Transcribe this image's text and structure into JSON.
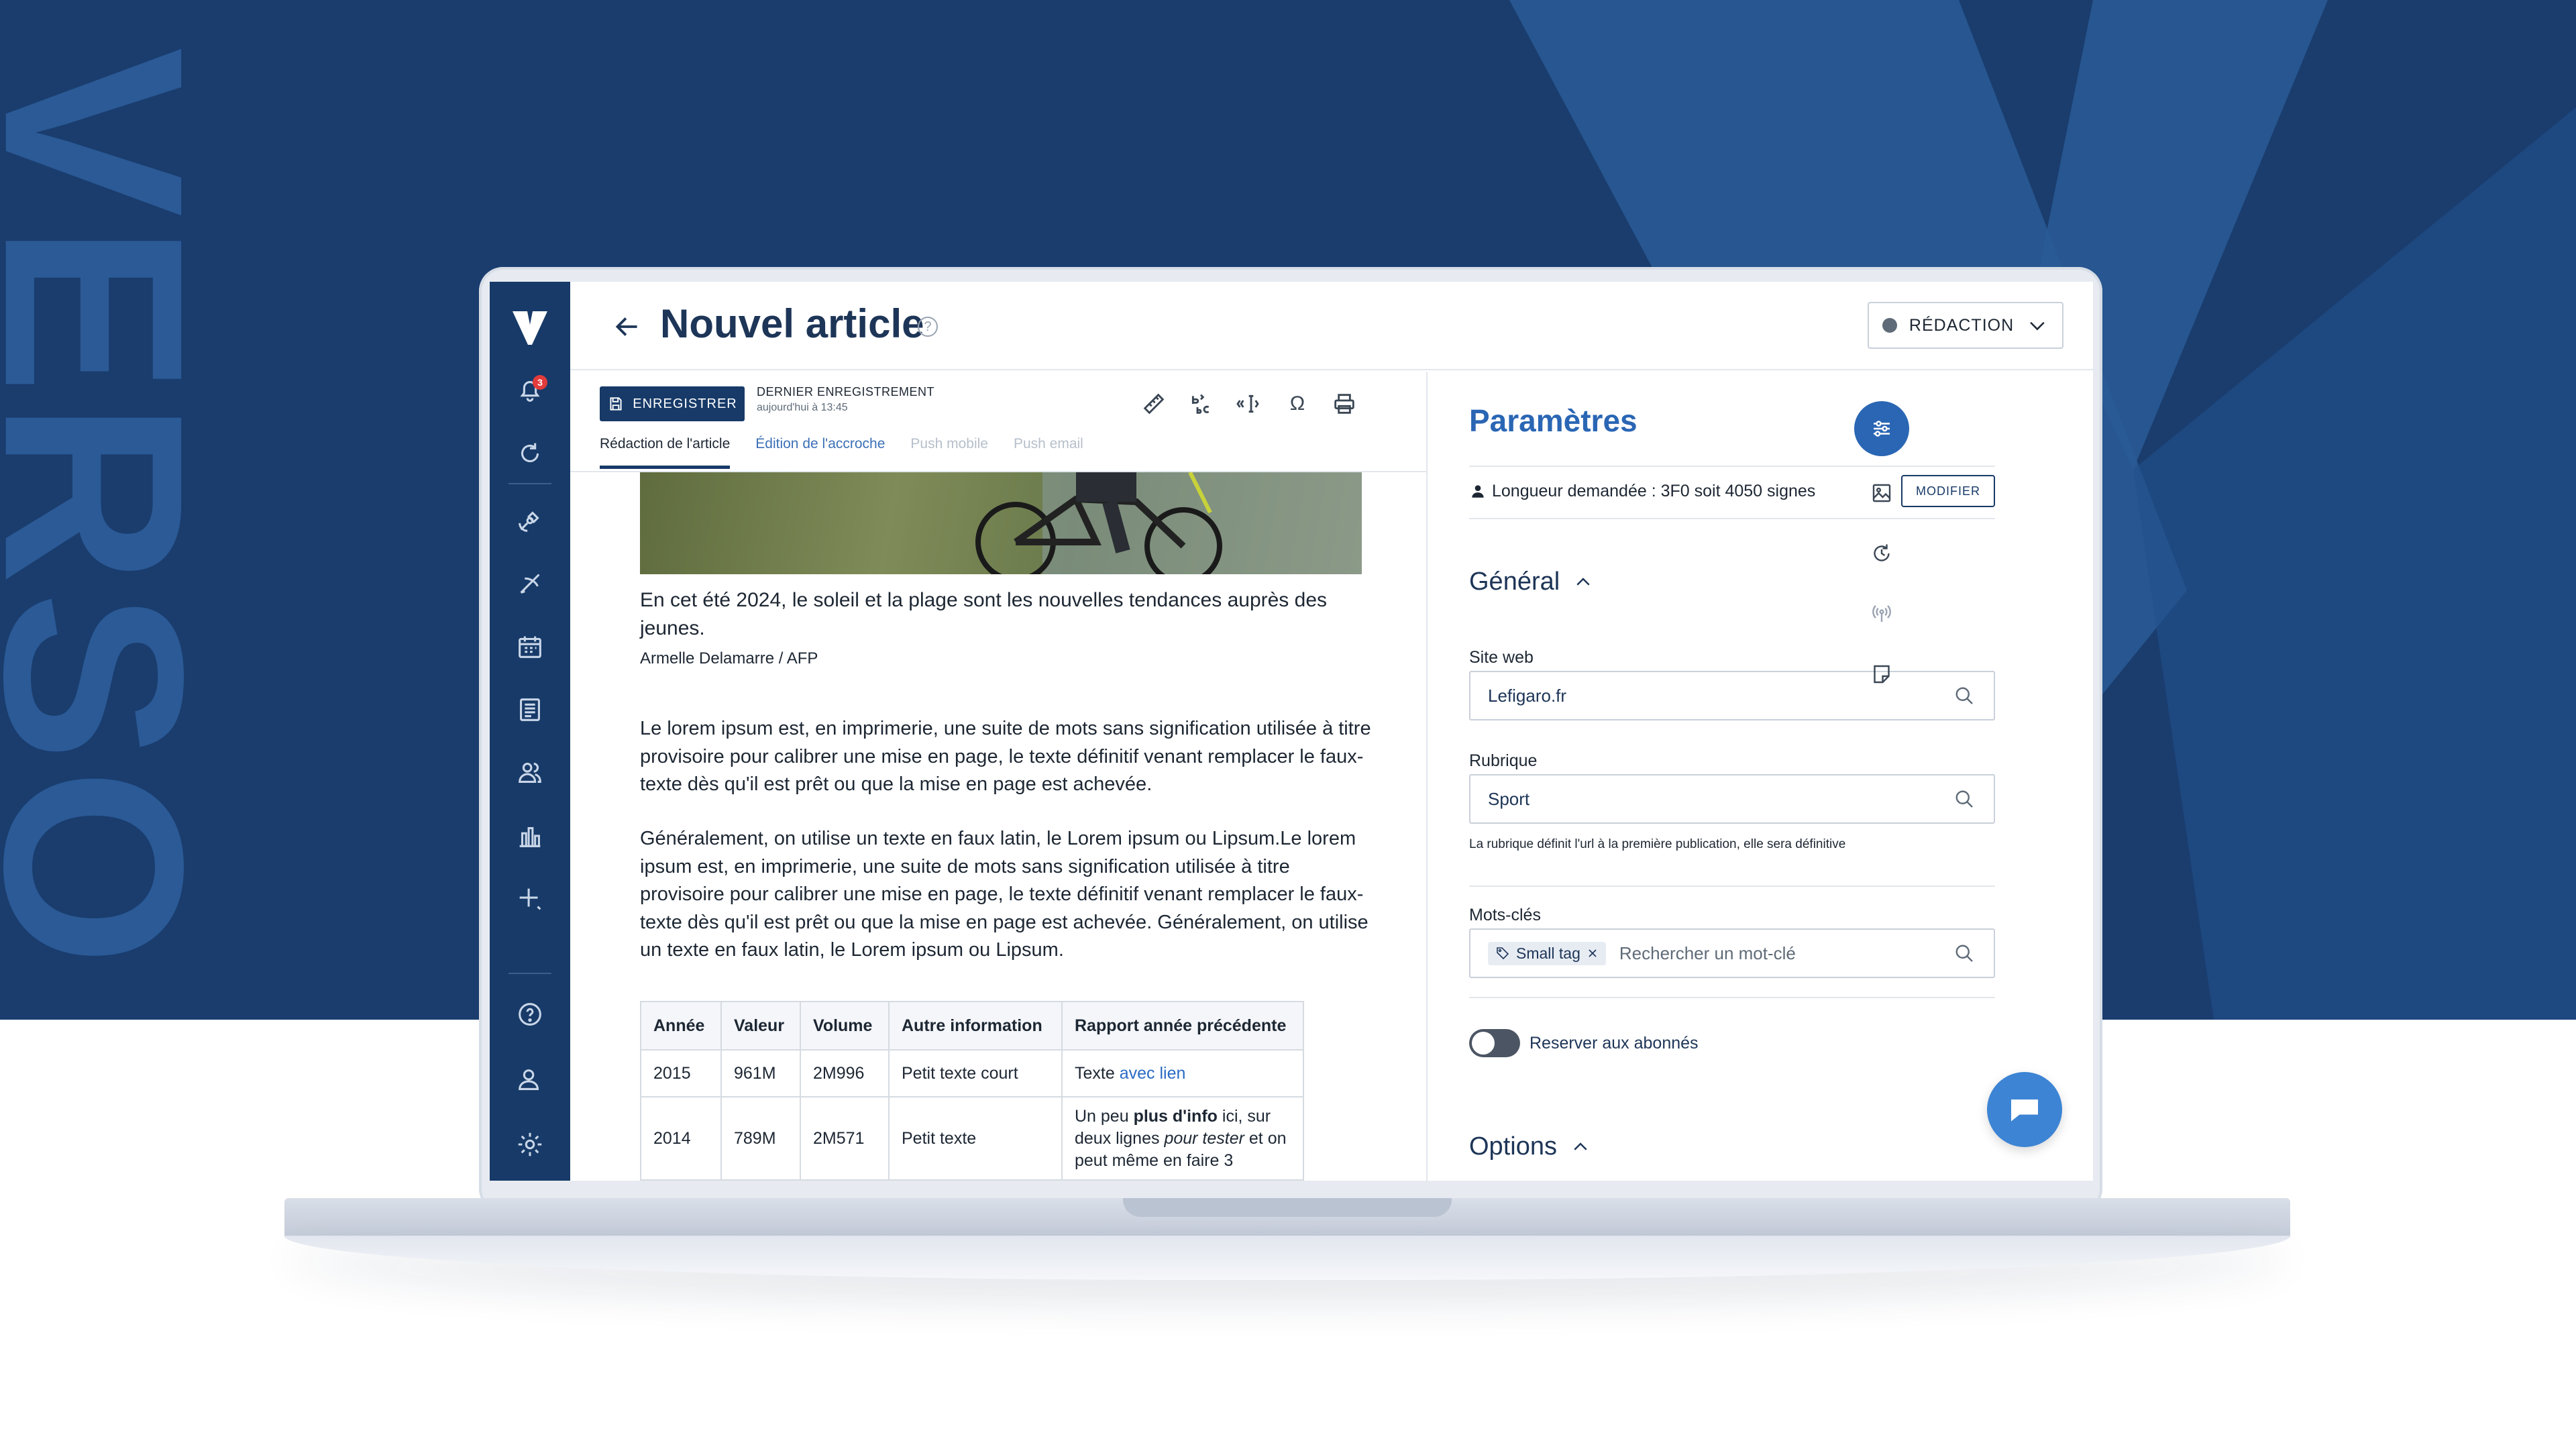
{
  "brand": {
    "wordmark": "VERSO",
    "logo_letter": "V"
  },
  "colors": {
    "navy": "#173a68",
    "accent": "#2a66b4",
    "link": "#2a6bc4",
    "badge": "#e23b3b"
  },
  "sidebar": {
    "notification_count": "3",
    "items": [
      {
        "name": "notifications",
        "icon": "bell-icon"
      },
      {
        "name": "history",
        "icon": "refresh-icon"
      },
      {
        "name": "broadcast",
        "icon": "satellite-icon"
      },
      {
        "name": "write",
        "icon": "feather-icon"
      },
      {
        "name": "planning",
        "icon": "calendar-icon"
      },
      {
        "name": "articles",
        "icon": "newspaper-icon"
      },
      {
        "name": "users",
        "icon": "users-icon"
      },
      {
        "name": "stats",
        "icon": "bar-chart-icon"
      },
      {
        "name": "add",
        "icon": "plus-icon"
      },
      {
        "name": "help",
        "icon": "help-icon"
      },
      {
        "name": "profile",
        "icon": "user-icon"
      },
      {
        "name": "settings",
        "icon": "gear-icon"
      }
    ]
  },
  "header": {
    "title": "Nouvel article",
    "help_symbol": "?",
    "status": "RÉDACTION"
  },
  "toolbar": {
    "save_label": "ENREGISTRER",
    "last_save_title": "DERNIER ENREGISTREMENT",
    "last_save_time": "aujourd'hui à 13:45",
    "icons": [
      "ruler-icon",
      "spellcheck-icon",
      "quote-cursor-icon",
      "omega-icon",
      "print-icon"
    ],
    "omega": "Ω",
    "tabs": [
      {
        "label": "Rédaction de l'article",
        "state": "active"
      },
      {
        "label": "Édition de l'accroche",
        "state": "normal"
      },
      {
        "label": "Push mobile",
        "state": "disabled"
      },
      {
        "label": "Push email",
        "state": "disabled"
      }
    ]
  },
  "article": {
    "caption": "En cet été 2024, le soleil et la plage sont les nouvelles tendances auprès des jeunes.",
    "credit": "Armelle Delamarre / AFP",
    "paragraph_1": "Le lorem ipsum est, en imprimerie, une suite de mots sans signification utilisée à titre provisoire pour calibrer une mise en page, le texte définitif venant remplacer le faux-texte dès qu'il est prêt ou que la mise en page est achevée.",
    "paragraph_2": "Généralement, on utilise un texte en faux latin, le Lorem ipsum ou Lipsum.Le lorem ipsum est, en imprimerie, une suite de mots sans signification utilisée à titre provisoire pour calibrer une mise en page, le texte définitif venant remplacer le faux-texte dès qu'il est prêt ou que la mise en page est achevée. Généralement, on utilise un texte en faux latin, le Lorem ipsum ou Lipsum.",
    "table": {
      "headers": [
        "Année",
        "Valeur",
        "Volume",
        "Autre information",
        "Rapport année précédente"
      ],
      "rows": [
        {
          "year": "2015",
          "value": "961M",
          "volume": "2M996",
          "info": "Petit texte court",
          "report_prefix": "Texte ",
          "report_link": "avec lien"
        },
        {
          "year": "2014",
          "value": "789M",
          "volume": "2M571",
          "info": "Petit texte",
          "report_a": "Un peu ",
          "report_bold": "plus d'info",
          "report_b": " ici, sur deux lignes ",
          "report_italic": "pour tester",
          "report_c": " et on peut même en faire 3"
        }
      ]
    }
  },
  "params": {
    "title": "Paramètres",
    "length_text": "Longueur demandée : 3F0 soit 4050 signes",
    "modify_label": "MODIFIER",
    "general_title": "Général",
    "site_label": "Site web",
    "site_value": "Lefigaro.fr",
    "rubrique_label": "Rubrique",
    "rubrique_value": "Sport",
    "rubrique_hint": "La rubrique définit l'url à la première publication, elle sera définitive",
    "keywords_label": "Mots-clés",
    "keyword_tag": "Small tag",
    "keywords_placeholder": "Rechercher un mot-clé",
    "subscribers_label": "Reserver aux abonnés",
    "subscribers_enabled": false,
    "options_title": "Options",
    "rail_icons": [
      "sliders-icon",
      "image-icon",
      "history-icon",
      "broadcast-icon",
      "note-icon"
    ]
  }
}
